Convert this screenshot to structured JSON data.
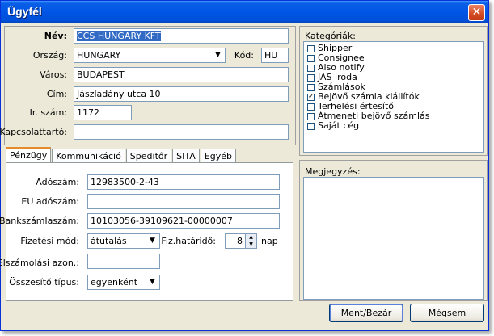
{
  "window": {
    "title": "Ügyfél",
    "close_glyph": "✕"
  },
  "form": {
    "nev_label": "Név:",
    "nev_value": "CCS HUNGARY KFT",
    "orszag_label": "Ország:",
    "orszag_value": "HUNGARY",
    "kod_label": "Kód:",
    "kod_value": "HU",
    "varos_label": "Város:",
    "varos_value": "BUDAPEST",
    "cim_label": "Cím:",
    "cim_value": "Jászladány utca 10",
    "irszam_label": "Ir. szám:",
    "irszam_value": "1172",
    "kapcsolat_label": "Kapcsolattartó:",
    "kapcsolat_value": ""
  },
  "tabs": [
    {
      "label": "Pénzügy"
    },
    {
      "label": "Kommunikáció"
    },
    {
      "label": "Speditőr"
    },
    {
      "label": "SITA"
    },
    {
      "label": "Egyéb"
    }
  ],
  "penzugy": {
    "adoszam_label": "Adószám:",
    "adoszam_value": "12983500-2-43",
    "eu_label": "EU adószám:",
    "eu_value": "",
    "bank_label": "Bankszámlaszám:",
    "bank_value": "10103056-39109621-00000007",
    "fizmod_label": "Fizetési mód:",
    "fizmod_value": "átutalás",
    "fizhat_label": "Fiz.határidő:",
    "fizhat_value": "8",
    "fizhat_unit": "nap",
    "elszam_label": "Elszámolási azon.:",
    "elszam_value": "",
    "osszesito_label": "Összesítő típus:",
    "osszesito_value": "egyenként"
  },
  "kategoriak": {
    "label": "Kategóriák:",
    "items": [
      {
        "label": "Shipper",
        "checked": false
      },
      {
        "label": "Consignee",
        "checked": false
      },
      {
        "label": "Also notify",
        "checked": false
      },
      {
        "label": "JAS iroda",
        "checked": false
      },
      {
        "label": "Számlások",
        "checked": false
      },
      {
        "label": "Bejövő számla kiállítók",
        "checked": true
      },
      {
        "label": "Terhelési értesítő",
        "checked": false
      },
      {
        "label": "Átmeneti bejövő számlás",
        "checked": false
      },
      {
        "label": "Saját cég",
        "checked": false
      }
    ]
  },
  "megjegyzes": {
    "label": "Megjegyzés:",
    "value": ""
  },
  "buttons": {
    "save": "Ment/Bezár",
    "cancel": "Mégsem"
  },
  "glyphs": {
    "dropdown": "▼",
    "spin_up": "▲",
    "spin_down": "▼",
    "check": "✓"
  }
}
